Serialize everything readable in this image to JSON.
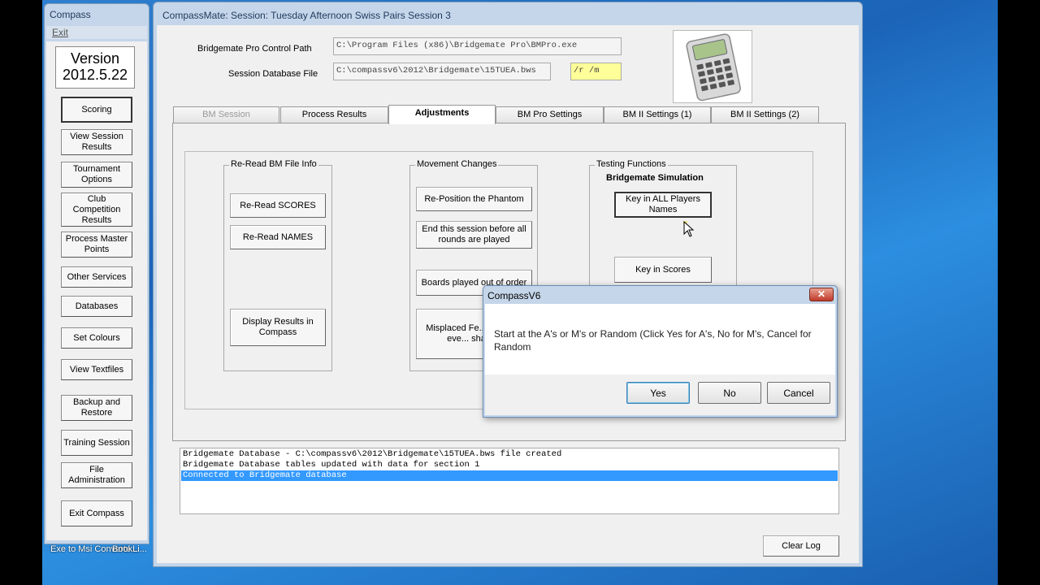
{
  "desktop": {
    "icons": [
      "Exe to Msi Converte...",
      "BookLi..."
    ]
  },
  "compass": {
    "title": "Compass",
    "menu_exit": "Exit",
    "version_label": "Version",
    "version_number": "2012.5.22",
    "buttons": [
      "Scoring",
      "View Session Results",
      "Tournament Options",
      "Club Competition Results",
      "Process Master Points",
      "Other Services",
      "Databases",
      "Set Colours",
      "View Textfiles",
      "Backup and Restore",
      "Training Session",
      "File Administration",
      "Exit Compass"
    ]
  },
  "mate": {
    "title": "CompassMate:   Session: Tuesday Afternoon Swiss Pairs Session  3",
    "control_path_label": "Bridgemate Pro Control Path",
    "control_path_value": "C:\\Program Files (x86)\\Bridgemate Pro\\BMPro.exe",
    "db_file_label": "Session Database File",
    "db_file_value": "C:\\compassv6\\2012\\Bridgemate\\15TUEA.bws",
    "switches_value": "/r /m",
    "tabs": [
      "BM Session",
      "Process Results",
      "Adjustments",
      "BM Pro Settings",
      "BM II Settings (1)",
      "BM II Settings (2)"
    ],
    "selected_tab": "Adjustments",
    "groups": {
      "reread": {
        "title": "Re-Read BM File Info",
        "buttons": [
          "Re-Read SCORES",
          "Re-Read  NAMES",
          "Display Results in Compass"
        ]
      },
      "movement": {
        "title": "Movement Changes",
        "buttons": [
          "Re-Position the Phantom",
          "End this session before all rounds are played",
          "Boards played out of order",
          "Misplaced Fe... (Mitchell eve... share..."
        ]
      },
      "testing": {
        "title": "Testing Functions",
        "subtitle": "Bridgemate Simulation",
        "buttons": [
          "Key in ALL Players Names",
          "Key in Scores"
        ]
      }
    },
    "log": [
      "Bridgemate Database - C:\\compassv6\\2012\\Bridgemate\\15TUEA.bws file created",
      "Bridgemate Database tables updated with data for section  1",
      "Connected to Bridgemate database"
    ],
    "clear_log": "Clear Log"
  },
  "dialog": {
    "title": "CompassV6",
    "message": "Start at the A's or M's or Random    (Click Yes for A's,  No for M's, Cancel for Random",
    "buttons": [
      "Yes",
      "No",
      "Cancel"
    ],
    "close": "✕"
  }
}
